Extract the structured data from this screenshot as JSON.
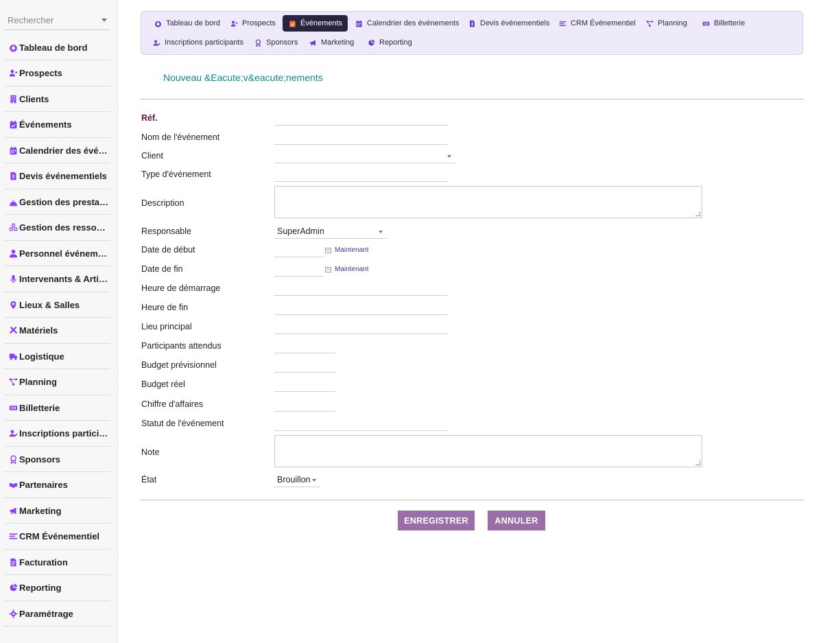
{
  "colors": {
    "accent": "#8b3dff",
    "active_tab_bg": "#2a2440",
    "title": "#0a8a8a",
    "button": "#9a6fa8",
    "required_label": "#6b0f44"
  },
  "sidebar": {
    "search_placeholder": "Rechercher",
    "items": [
      {
        "label": "Tableau de bord",
        "icon": "dashboard-icon"
      },
      {
        "label": "Prospects",
        "icon": "user-plus-icon"
      },
      {
        "label": "Clients",
        "icon": "building-icon"
      },
      {
        "label": "Événements",
        "icon": "calendar-check-icon"
      },
      {
        "label": "Calendrier des événements",
        "icon": "calendar-icon"
      },
      {
        "label": "Devis événementiels",
        "icon": "invoice-icon"
      },
      {
        "label": "Gestion des prestations",
        "icon": "cloche-icon"
      },
      {
        "label": "Gestion des ressources",
        "icon": "cubes-icon"
      },
      {
        "label": "Personnel événementiel",
        "icon": "user-tie-icon"
      },
      {
        "label": "Intervenants & Artistes",
        "icon": "microphone-icon"
      },
      {
        "label": "Lieux & Salles",
        "icon": "map-marker-icon"
      },
      {
        "label": "Matériels",
        "icon": "tools-icon"
      },
      {
        "label": "Logistique",
        "icon": "truck-icon"
      },
      {
        "label": "Planning",
        "icon": "project-diagram-icon"
      },
      {
        "label": "Billetterie",
        "icon": "ticket-icon"
      },
      {
        "label": "Inscriptions participants",
        "icon": "user-edit-icon"
      },
      {
        "label": "Sponsors",
        "icon": "award-icon"
      },
      {
        "label": "Partenaires",
        "icon": "handshake-icon"
      },
      {
        "label": "Marketing",
        "icon": "bullhorn-icon"
      },
      {
        "label": "CRM Événementiel",
        "icon": "list-icon"
      },
      {
        "label": "Facturation",
        "icon": "file-invoice-icon"
      },
      {
        "label": "Reporting",
        "icon": "pie-chart-icon"
      },
      {
        "label": "Paramétrage",
        "icon": "gear-icon"
      }
    ]
  },
  "tabs": [
    {
      "label": "Tableau de bord",
      "icon": "dashboard-icon"
    },
    {
      "label": "Prospects",
      "icon": "user-plus-icon"
    },
    {
      "label": "Événements",
      "icon": "calendar-check-icon",
      "active": true
    },
    {
      "label": "Calendrier des événements",
      "icon": "calendar-icon"
    },
    {
      "label": "Devis événementiels",
      "icon": "invoice-icon"
    },
    {
      "label": "CRM Événementiel",
      "icon": "list-icon"
    },
    {
      "label": "Planning",
      "icon": "project-diagram-icon"
    },
    {
      "label": "Billetterie",
      "icon": "ticket-icon"
    },
    {
      "label": "Inscriptions participants",
      "icon": "user-edit-icon"
    },
    {
      "label": "Sponsors",
      "icon": "award-icon"
    },
    {
      "label": "Marketing",
      "icon": "bullhorn-icon"
    },
    {
      "label": "Reporting",
      "icon": "pie-chart-icon"
    }
  ],
  "page": {
    "title": "Nouveau &Eacute;v&eacute;nements"
  },
  "form": {
    "ref": "Réf.",
    "nom": "Nom de l'événement",
    "client": "Client",
    "client_value": "",
    "type": "Type d'événement",
    "description": "Description",
    "responsable": "Responsable",
    "responsable_value": "SuperAdmin",
    "date_debut": "Date de début",
    "date_fin": "Date de fin",
    "now_label": "Maintenant",
    "heure_debut": "Heure de démarrage",
    "heure_fin": "Heure de fin",
    "lieu": "Lieu principal",
    "participants": "Participants attendus",
    "budget_prev": "Budget prévisionnel",
    "budget_reel": "Budget réel",
    "ca": "Chiffre d'affaires",
    "statut": "Statut de l'événement",
    "note": "Note",
    "etat": "État",
    "etat_value": "Brouillon"
  },
  "buttons": {
    "save": "ENREGISTRER",
    "cancel": "ANNULER"
  }
}
